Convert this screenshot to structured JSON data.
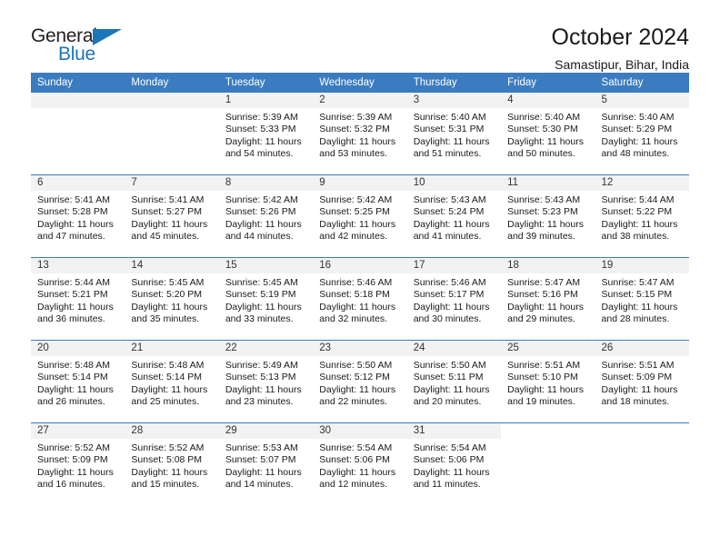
{
  "brand": {
    "name_top": "General",
    "name_bottom": "Blue",
    "accent_color": "#1b75bb"
  },
  "header": {
    "title": "October 2024",
    "subtitle": "Samastipur, Bihar, India",
    "header_bg": "#3b7cc0",
    "daycell_bg": "#f2f2f2"
  },
  "calendar": {
    "weekday_headers": [
      "Sunday",
      "Monday",
      "Tuesday",
      "Wednesday",
      "Thursday",
      "Friday",
      "Saturday"
    ],
    "weeks": [
      [
        {
          "day": "",
          "empty": true
        },
        {
          "day": "",
          "empty": true
        },
        {
          "day": "1",
          "sunrise": "Sunrise: 5:39 AM",
          "sunset": "Sunset: 5:33 PM",
          "daylight": "Daylight: 11 hours and 54 minutes."
        },
        {
          "day": "2",
          "sunrise": "Sunrise: 5:39 AM",
          "sunset": "Sunset: 5:32 PM",
          "daylight": "Daylight: 11 hours and 53 minutes."
        },
        {
          "day": "3",
          "sunrise": "Sunrise: 5:40 AM",
          "sunset": "Sunset: 5:31 PM",
          "daylight": "Daylight: 11 hours and 51 minutes."
        },
        {
          "day": "4",
          "sunrise": "Sunrise: 5:40 AM",
          "sunset": "Sunset: 5:30 PM",
          "daylight": "Daylight: 11 hours and 50 minutes."
        },
        {
          "day": "5",
          "sunrise": "Sunrise: 5:40 AM",
          "sunset": "Sunset: 5:29 PM",
          "daylight": "Daylight: 11 hours and 48 minutes."
        }
      ],
      [
        {
          "day": "6",
          "sunrise": "Sunrise: 5:41 AM",
          "sunset": "Sunset: 5:28 PM",
          "daylight": "Daylight: 11 hours and 47 minutes."
        },
        {
          "day": "7",
          "sunrise": "Sunrise: 5:41 AM",
          "sunset": "Sunset: 5:27 PM",
          "daylight": "Daylight: 11 hours and 45 minutes."
        },
        {
          "day": "8",
          "sunrise": "Sunrise: 5:42 AM",
          "sunset": "Sunset: 5:26 PM",
          "daylight": "Daylight: 11 hours and 44 minutes."
        },
        {
          "day": "9",
          "sunrise": "Sunrise: 5:42 AM",
          "sunset": "Sunset: 5:25 PM",
          "daylight": "Daylight: 11 hours and 42 minutes."
        },
        {
          "day": "10",
          "sunrise": "Sunrise: 5:43 AM",
          "sunset": "Sunset: 5:24 PM",
          "daylight": "Daylight: 11 hours and 41 minutes."
        },
        {
          "day": "11",
          "sunrise": "Sunrise: 5:43 AM",
          "sunset": "Sunset: 5:23 PM",
          "daylight": "Daylight: 11 hours and 39 minutes."
        },
        {
          "day": "12",
          "sunrise": "Sunrise: 5:44 AM",
          "sunset": "Sunset: 5:22 PM",
          "daylight": "Daylight: 11 hours and 38 minutes."
        }
      ],
      [
        {
          "day": "13",
          "sunrise": "Sunrise: 5:44 AM",
          "sunset": "Sunset: 5:21 PM",
          "daylight": "Daylight: 11 hours and 36 minutes."
        },
        {
          "day": "14",
          "sunrise": "Sunrise: 5:45 AM",
          "sunset": "Sunset: 5:20 PM",
          "daylight": "Daylight: 11 hours and 35 minutes."
        },
        {
          "day": "15",
          "sunrise": "Sunrise: 5:45 AM",
          "sunset": "Sunset: 5:19 PM",
          "daylight": "Daylight: 11 hours and 33 minutes."
        },
        {
          "day": "16",
          "sunrise": "Sunrise: 5:46 AM",
          "sunset": "Sunset: 5:18 PM",
          "daylight": "Daylight: 11 hours and 32 minutes."
        },
        {
          "day": "17",
          "sunrise": "Sunrise: 5:46 AM",
          "sunset": "Sunset: 5:17 PM",
          "daylight": "Daylight: 11 hours and 30 minutes."
        },
        {
          "day": "18",
          "sunrise": "Sunrise: 5:47 AM",
          "sunset": "Sunset: 5:16 PM",
          "daylight": "Daylight: 11 hours and 29 minutes."
        },
        {
          "day": "19",
          "sunrise": "Sunrise: 5:47 AM",
          "sunset": "Sunset: 5:15 PM",
          "daylight": "Daylight: 11 hours and 28 minutes."
        }
      ],
      [
        {
          "day": "20",
          "sunrise": "Sunrise: 5:48 AM",
          "sunset": "Sunset: 5:14 PM",
          "daylight": "Daylight: 11 hours and 26 minutes."
        },
        {
          "day": "21",
          "sunrise": "Sunrise: 5:48 AM",
          "sunset": "Sunset: 5:14 PM",
          "daylight": "Daylight: 11 hours and 25 minutes."
        },
        {
          "day": "22",
          "sunrise": "Sunrise: 5:49 AM",
          "sunset": "Sunset: 5:13 PM",
          "daylight": "Daylight: 11 hours and 23 minutes."
        },
        {
          "day": "23",
          "sunrise": "Sunrise: 5:50 AM",
          "sunset": "Sunset: 5:12 PM",
          "daylight": "Daylight: 11 hours and 22 minutes."
        },
        {
          "day": "24",
          "sunrise": "Sunrise: 5:50 AM",
          "sunset": "Sunset: 5:11 PM",
          "daylight": "Daylight: 11 hours and 20 minutes."
        },
        {
          "day": "25",
          "sunrise": "Sunrise: 5:51 AM",
          "sunset": "Sunset: 5:10 PM",
          "daylight": "Daylight: 11 hours and 19 minutes."
        },
        {
          "day": "26",
          "sunrise": "Sunrise: 5:51 AM",
          "sunset": "Sunset: 5:09 PM",
          "daylight": "Daylight: 11 hours and 18 minutes."
        }
      ],
      [
        {
          "day": "27",
          "sunrise": "Sunrise: 5:52 AM",
          "sunset": "Sunset: 5:09 PM",
          "daylight": "Daylight: 11 hours and 16 minutes."
        },
        {
          "day": "28",
          "sunrise": "Sunrise: 5:52 AM",
          "sunset": "Sunset: 5:08 PM",
          "daylight": "Daylight: 11 hours and 15 minutes."
        },
        {
          "day": "29",
          "sunrise": "Sunrise: 5:53 AM",
          "sunset": "Sunset: 5:07 PM",
          "daylight": "Daylight: 11 hours and 14 minutes."
        },
        {
          "day": "30",
          "sunrise": "Sunrise: 5:54 AM",
          "sunset": "Sunset: 5:06 PM",
          "daylight": "Daylight: 11 hours and 12 minutes."
        },
        {
          "day": "31",
          "sunrise": "Sunrise: 5:54 AM",
          "sunset": "Sunset: 5:06 PM",
          "daylight": "Daylight: 11 hours and 11 minutes."
        },
        {
          "day": "",
          "empty": true,
          "blank": true
        },
        {
          "day": "",
          "empty": true,
          "blank": true
        }
      ]
    ]
  }
}
